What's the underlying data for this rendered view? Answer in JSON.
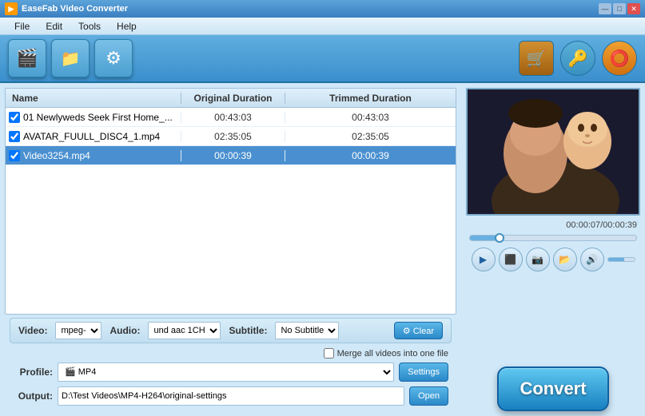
{
  "app": {
    "title": "EaseFab Video Converter"
  },
  "titlebar": {
    "title": "EaseFab Video Converter",
    "min_btn": "—",
    "max_btn": "□",
    "close_btn": "✕"
  },
  "menu": {
    "items": [
      "File",
      "Edit",
      "Tools",
      "Help"
    ]
  },
  "toolbar": {
    "add_video_icon": "🎬",
    "add_folder_icon": "📁",
    "settings_icon": "⚙"
  },
  "table": {
    "headers": {
      "name": "Name",
      "original": "Original Duration",
      "trimmed": "Trimmed Duration"
    },
    "rows": [
      {
        "name": "01 Newlyweds Seek First Home_...",
        "original": "00:43:03",
        "trimmed": "00:43:03",
        "checked": true,
        "selected": false
      },
      {
        "name": "AVATAR_FUULL_DISC4_1.mp4",
        "original": "02:35:05",
        "trimmed": "02:35:05",
        "checked": true,
        "selected": false
      },
      {
        "name": "Video3254.mp4",
        "original": "00:00:39",
        "trimmed": "00:00:39",
        "checked": true,
        "selected": true
      }
    ]
  },
  "controls": {
    "video_label": "Video:",
    "video_value": "mpeg-",
    "audio_label": "Audio:",
    "audio_value": "und aac 1CH",
    "subtitle_label": "Subtitle:",
    "subtitle_value": "No Subtitle",
    "clear_btn": "⚙ Clear",
    "merge_label": "Merge all videos into one file",
    "profile_label": "Profile:",
    "profile_value": "🎬 MP4",
    "settings_btn": "Settings",
    "output_label": "Output:",
    "output_value": "D:\\Test Videos\\MP4-H264\\original-settings",
    "open_btn": "Open"
  },
  "preview": {
    "time_current": "00:00:07",
    "time_total": "00:00:39",
    "time_display": "00:00:07/00:00:39"
  },
  "convert": {
    "label": "Convert"
  }
}
